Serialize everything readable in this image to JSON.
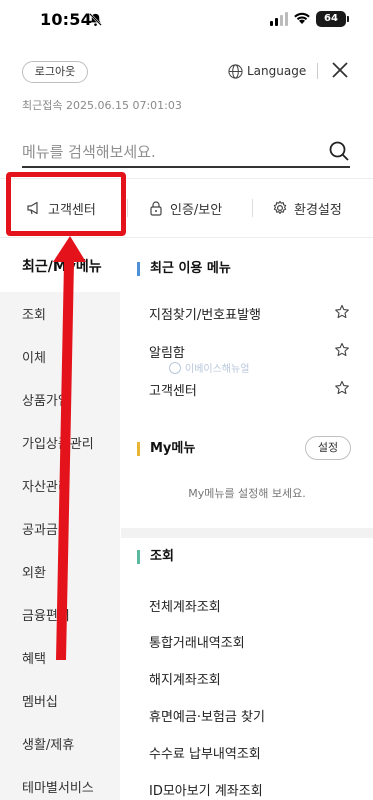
{
  "status_bar": {
    "time": "10:54",
    "battery": "64"
  },
  "header": {
    "logout_label": "로그아웃",
    "language_label": "Language",
    "last_login": "최근접속 2025.06.15 07:01:03"
  },
  "search": {
    "placeholder": "메뉴를 검색해보세요."
  },
  "quick_menu": [
    {
      "label": "고객센터",
      "icon": "megaphone-icon"
    },
    {
      "label": "인증/보안",
      "icon": "lock-icon"
    },
    {
      "label": "환경설정",
      "icon": "gear-icon"
    }
  ],
  "categories": [
    "최근/My메뉴",
    "조회",
    "이체",
    "상품가입",
    "가입상품관리",
    "자산관리",
    "공과금",
    "외환",
    "금융편의",
    "혜택",
    "멤버십",
    "생활/제휴",
    "테마별서비스"
  ],
  "recent": {
    "title": "최근 이용 메뉴",
    "items": [
      "지점찾기/번호표발행",
      "알림함",
      "고객센터"
    ]
  },
  "my_menu": {
    "title": "My메뉴",
    "setting_label": "설정",
    "empty_text": "My메뉴를 설정해 보세요."
  },
  "inquiry": {
    "title": "조회",
    "items": [
      "전체계좌조회",
      "통합거래내역조회",
      "해지계좌조회",
      "휴면예금·보험금 찾기",
      "수수료 납부내역조회",
      "ID모아보기 계좌조회"
    ]
  },
  "watermark": "이베이스해뉴얼",
  "colors": {
    "highlight": "#e4131b",
    "recent_bar": "#4f8fd6",
    "my_bar": "#e8b634",
    "inquiry_bar": "#5bb9a0"
  }
}
